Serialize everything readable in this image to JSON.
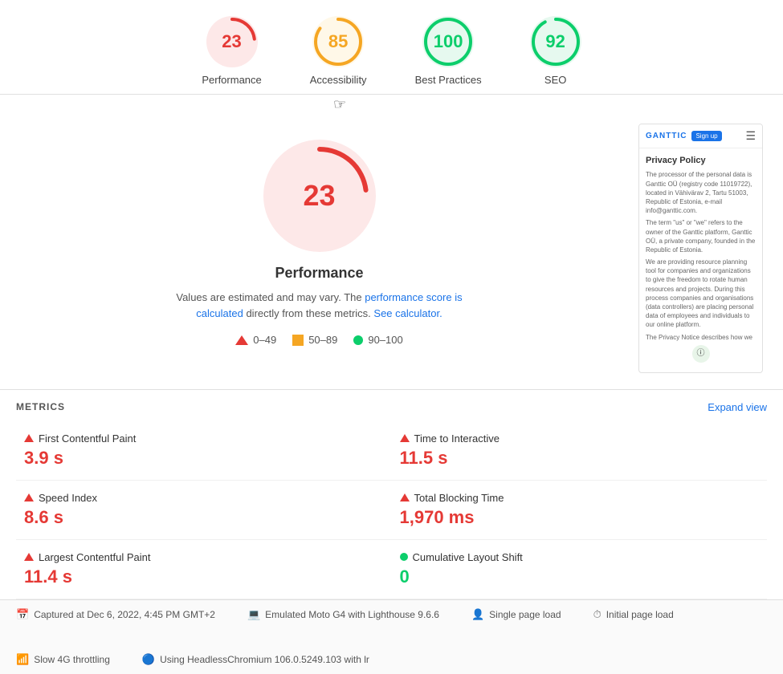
{
  "scores": [
    {
      "id": "performance",
      "value": 23,
      "label": "Performance",
      "type": "red",
      "percent": 23
    },
    {
      "id": "accessibility",
      "value": 85,
      "label": "Accessibility",
      "type": "orange",
      "percent": 85
    },
    {
      "id": "best-practices",
      "value": 100,
      "label": "Best Practices",
      "type": "green",
      "percent": 100
    },
    {
      "id": "seo",
      "value": 92,
      "label": "SEO",
      "type": "green",
      "percent": 92
    }
  ],
  "main": {
    "big_score": 23,
    "title": "Performance",
    "description_prefix": "Values are estimated and may vary. The ",
    "description_link": "performance score is calculated",
    "description_suffix": " directly from these metrics.",
    "calculator_link": "See calculator.",
    "legend": [
      {
        "id": "red",
        "range": "0–49"
      },
      {
        "id": "orange",
        "range": "50–89"
      },
      {
        "id": "green",
        "range": "90–100"
      }
    ]
  },
  "preview": {
    "logo": "GANTTIC",
    "signup": "Sign up",
    "heading": "Privacy Policy",
    "para1": "The processor of the personal data is Ganttic OÜ (registry code 11019722), located in Vähivärav 2, Tartu 51003, Republic of Estonia, e-mail info@ganttic.com.",
    "para2": "The term \"us\" or \"we\" refers to the owner of the Ganttic platform, Ganttic OÜ, a private company, founded in the Republic of Estonia.",
    "para3": "We are providing resource planning tool for companies and organizations to give the freedom to rotate human resources and projects. During this process companies and organisations (data controllers) are placing personal data of employees and individuals to our online platform.",
    "para4": "The Privacy Notice describes how we",
    "badge": "ⓘ"
  },
  "metrics": {
    "section_title": "METRICS",
    "expand_label": "Expand view",
    "items": [
      {
        "id": "fcp",
        "label": "First Contentful Paint",
        "value": "3.9 s",
        "type": "red"
      },
      {
        "id": "tti",
        "label": "Time to Interactive",
        "value": "11.5 s",
        "type": "red"
      },
      {
        "id": "si",
        "label": "Speed Index",
        "value": "8.6 s",
        "type": "red"
      },
      {
        "id": "tbt",
        "label": "Total Blocking Time",
        "value": "1,970 ms",
        "type": "red"
      },
      {
        "id": "lcp",
        "label": "Largest Contentful Paint",
        "value": "11.4 s",
        "type": "red"
      },
      {
        "id": "cls",
        "label": "Cumulative Layout Shift",
        "value": "0",
        "type": "green"
      }
    ]
  },
  "footer": {
    "items": [
      {
        "id": "captured",
        "icon": "📅",
        "text": "Captured at Dec 6, 2022, 4:45 PM GMT+2"
      },
      {
        "id": "device",
        "icon": "💻",
        "text": "Emulated Moto G4 with Lighthouse 9.6.6"
      },
      {
        "id": "load-type",
        "icon": "👤",
        "text": "Single page load"
      },
      {
        "id": "page-load",
        "icon": "⏱",
        "text": "Initial page load"
      },
      {
        "id": "throttling",
        "icon": "📶",
        "text": "Slow 4G throttling"
      },
      {
        "id": "browser",
        "icon": "🔵",
        "text": "Using HeadlessChromium 106.0.5249.103 with lr"
      }
    ]
  },
  "colors": {
    "red": "#e53935",
    "orange": "#f5a623",
    "green": "#0cce6b",
    "blue": "#1a73e8"
  }
}
